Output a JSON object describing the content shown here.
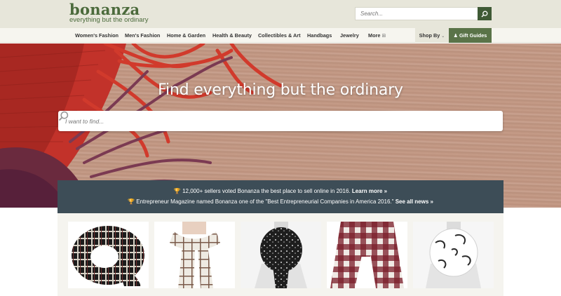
{
  "brand": {
    "name": "bonanza",
    "tagline": "everything but the ordinary",
    "color": "#4b6a3b"
  },
  "header_search": {
    "placeholder": "Search...",
    "button_icon": "search-icon"
  },
  "nav": {
    "items": [
      {
        "label": "Women's Fashion"
      },
      {
        "label": "Men's Fashion"
      },
      {
        "label": "Home & Garden"
      },
      {
        "label": "Health & Beauty"
      },
      {
        "label": "Collectibles & Art"
      },
      {
        "label": "Handbags"
      },
      {
        "label": "Jewelry"
      },
      {
        "label": "More",
        "icon": "plus-box-icon"
      }
    ],
    "shop_by": {
      "label": "Shop By",
      "icon": "chevron-down-icon"
    },
    "gift_guides": {
      "label": "Gift Guides",
      "icon": "gift-icon",
      "color": "#5a7348"
    }
  },
  "hero": {
    "title": "Find everything but the ordinary",
    "search_placeholder": "I want to find...",
    "search_icon": "search-icon"
  },
  "promo": {
    "color": "#3d4d57",
    "line1_text": "12,000+ sellers voted Bonanza the best place to sell online in 2016.",
    "line1_link": "Learn more »",
    "line2_text": "Entrepreneur Magazine named Bonanza one of the \"Best Entrepreneurial Companies in America 2016.\"",
    "line2_link": "See all news »",
    "icon": "trophy-icon"
  },
  "products": [
    {
      "name": "scarf-black-white-plaid"
    },
    {
      "name": "scarf-white-grid"
    },
    {
      "name": "scarf-black-white-print"
    },
    {
      "name": "scarf-maroon-buffalo-check"
    },
    {
      "name": "scarf-white-black-floral"
    }
  ]
}
